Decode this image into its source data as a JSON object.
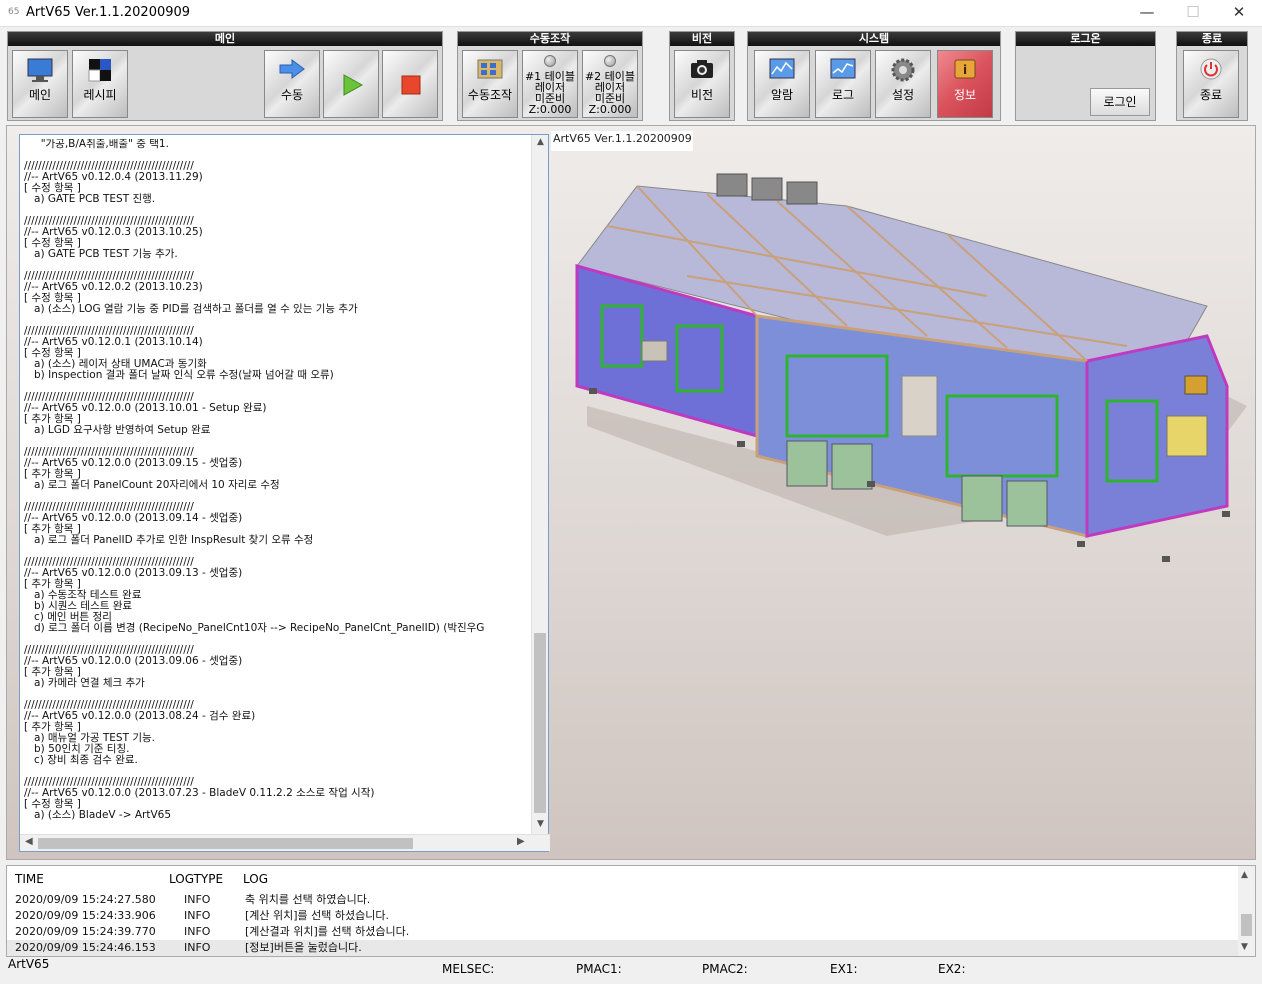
{
  "window": {
    "icon_text": "65",
    "title": "ArtV65 Ver.1.1.20200909",
    "minimize": "—",
    "maximize": "☐",
    "close": "✕"
  },
  "toolbar": {
    "groups": [
      {
        "header": "메인",
        "buttons": [
          "메인",
          "레시피",
          "수동"
        ]
      },
      {
        "header": "수동조작",
        "buttons": [
          "수동조작",
          "#1 테이블\n레이저\n미준비\nZ:0.000",
          "#2 테이블\n레이저\n미준비\nZ:0.000"
        ]
      },
      {
        "header": "비전",
        "buttons": [
          "비전"
        ]
      },
      {
        "header": "시스템",
        "buttons": [
          "알람",
          "로그",
          "설정",
          "정보"
        ]
      },
      {
        "header": "로그온",
        "buttons": [
          "로그인"
        ]
      },
      {
        "header": "종료",
        "buttons": [
          "종료"
        ]
      }
    ]
  },
  "version_label": "ArtV65 Ver.1.1.20200909",
  "changelog": [
    "     \"가공,B/A취출,배출\" 중 택1.",
    "",
    "////////////////////////////////////////////////",
    "//-- ArtV65 v0.12.0.4 (2013.11.29)",
    "[ 수정 항목 ]",
    "   a) GATE PCB TEST 진행.",
    "",
    "////////////////////////////////////////////////",
    "//-- ArtV65 v0.12.0.3 (2013.10.25)",
    "[ 수정 항목 ]",
    "   a) GATE PCB TEST 기능 추가.",
    "",
    "////////////////////////////////////////////////",
    "//-- ArtV65 v0.12.0.2 (2013.10.23)",
    "[ 수정 항목 ]",
    "   a) (소스) LOG 열람 기능 중 PID를 검색하고 폴더를 열 수 있는 기능 추가",
    "",
    "////////////////////////////////////////////////",
    "//-- ArtV65 v0.12.0.1 (2013.10.14)",
    "[ 수정 항목 ]",
    "   a) (소스) 레이저 상태 UMAC과 동기화",
    "   b) Inspection 결과 폴더 날짜 인식 오류 수정(날짜 넘어갈 때 오류)",
    "",
    "////////////////////////////////////////////////",
    "//-- ArtV65 v0.12.0.0 (2013.10.01 - Setup 완료)",
    "[ 추가 항목 ]",
    "   a) LGD 요구사항 반영하여 Setup 완료",
    "",
    "////////////////////////////////////////////////",
    "//-- ArtV65 v0.12.0.0 (2013.09.15 - 셋업중)",
    "[ 추가 항목 ]",
    "   a) 로그 폴더 PanelCount 20자리에서 10 자리로 수정",
    "",
    "////////////////////////////////////////////////",
    "//-- ArtV65 v0.12.0.0 (2013.09.14 - 셋업중)",
    "[ 추가 항목 ]",
    "   a) 로그 폴더 PanelID 추가로 인한 InspResult 찾기 오류 수정",
    "",
    "////////////////////////////////////////////////",
    "//-- ArtV65 v0.12.0.0 (2013.09.13 - 셋업중)",
    "[ 추가 항목 ]",
    "   a) 수동조작 테스트 완료",
    "   b) 시퀀스 테스트 완료",
    "   c) 메인 버튼 정리",
    "   d) 로그 폴더 이름 변경 (RecipeNo_PanelCnt10자 --> RecipeNo_PanelCnt_PanelID) (박진우G",
    "",
    "////////////////////////////////////////////////",
    "//-- ArtV65 v0.12.0.0 (2013.09.06 - 셋업중)",
    "[ 추가 항목 ]",
    "   a) 카메라 연결 체크 추가",
    "",
    "////////////////////////////////////////////////",
    "//-- ArtV65 v0.12.0.0 (2013.08.24 - 검수 완료)",
    "[ 추가 항목 ]",
    "   a) 매뉴얼 가공 TEST 기능.",
    "   b) 50인치 기준 티칭.",
    "   c) 장비 최종 검수 완료.",
    "",
    "////////////////////////////////////////////////",
    "//-- ArtV65 v0.12.0.0 (2013.07.23 - BladeV 0.11.2.2 소스로 작업 시작)",
    "[ 수정 항목 ]",
    "   a) (소스) BladeV -> ArtV65"
  ],
  "log": {
    "columns": [
      "TIME",
      "LOGTYPE",
      "LOG"
    ],
    "rows": [
      [
        "2020/09/09 15:24:27.580",
        "INFO",
        "축 위치를 선택 하였습니다."
      ],
      [
        "2020/09/09 15:24:33.906",
        "INFO",
        "[계산 위치]를 선택 하셨습니다."
      ],
      [
        "2020/09/09 15:24:39.770",
        "INFO",
        "[계산결과 위치]를 선택 하셨습니다."
      ],
      [
        "2020/09/09 15:24:46.153",
        "INFO",
        "[정보]버튼을 눌렀습니다."
      ]
    ]
  },
  "status": {
    "app": "ArtV65",
    "melsec": "MELSEC:",
    "pmac1": "PMAC1:",
    "pmac2": "PMAC2:",
    "ex1": "EX1:",
    "ex2": "EX2:"
  },
  "colors": {
    "group_header_bg": "#1a1a1a",
    "info_button_bg": "#d9525c",
    "text_panel_border": "#7a9ccd"
  }
}
